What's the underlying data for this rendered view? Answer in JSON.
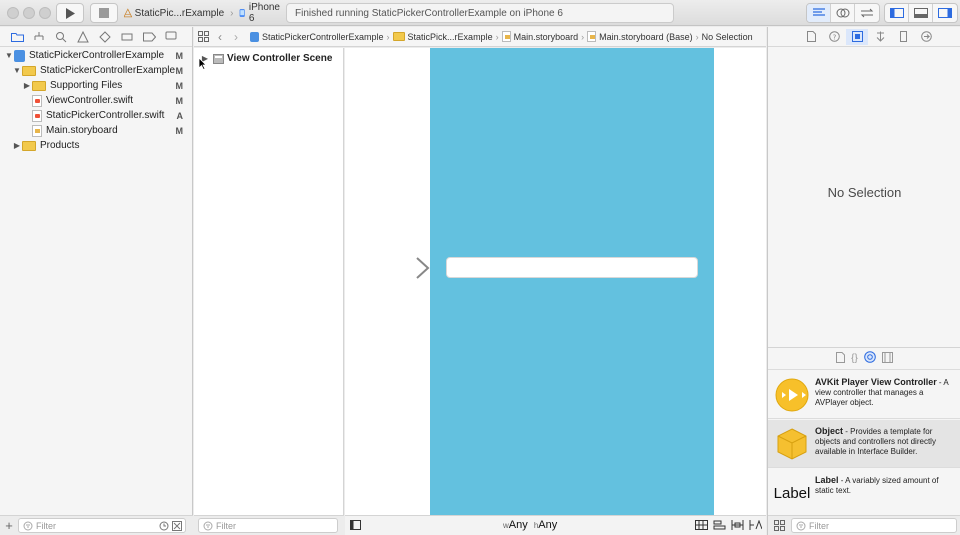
{
  "toolbar": {
    "scheme_target": "StaticPic...rExample",
    "device": "iPhone 6",
    "status": "Finished running StaticPickerControllerExample on iPhone 6"
  },
  "navigator": {
    "items": [
      {
        "label": "StaticPickerControllerExample",
        "badge": "M",
        "kind": "project",
        "level": 0,
        "expanded": true
      },
      {
        "label": "StaticPickerControllerExample",
        "badge": "M",
        "kind": "folder",
        "level": 1,
        "expanded": true
      },
      {
        "label": "Supporting Files",
        "badge": "M",
        "kind": "folder",
        "level": 2,
        "expanded": false
      },
      {
        "label": "ViewController.swift",
        "badge": "M",
        "kind": "swift",
        "level": 2
      },
      {
        "label": "StaticPickerController.swift",
        "badge": "A",
        "kind": "swift",
        "level": 2
      },
      {
        "label": "Main.storyboard",
        "badge": "M",
        "kind": "storyboard",
        "level": 2
      },
      {
        "label": "Products",
        "badge": "",
        "kind": "folder",
        "level": 1,
        "expanded": false
      }
    ],
    "filter_placeholder": "Filter"
  },
  "jumpbar": {
    "crumbs": [
      "StaticPickerControllerExample",
      "StaticPick...rExample",
      "Main.storyboard",
      "Main.storyboard (Base)",
      "No Selection"
    ]
  },
  "outline": {
    "scene": "View Controller Scene",
    "filter_placeholder": "Filter"
  },
  "canvas": {
    "size_class_w_prefix": "w",
    "size_class_w": "Any",
    "size_class_h_prefix": "h",
    "size_class_h": "Any"
  },
  "inspector": {
    "empty_text": "No Selection"
  },
  "library": {
    "items": [
      {
        "title": "AVKit Player View Controller",
        "desc": " - A view controller that manages a AVPlayer object."
      },
      {
        "title": "Object",
        "desc": " - Provides a template for objects and controllers not directly available in Interface Builder."
      },
      {
        "title": "Label",
        "desc": " - A variably sized amount of static text.",
        "icon_text": "Label"
      }
    ],
    "filter_placeholder": "Filter"
  },
  "colors": {
    "view_background": "#63c1df",
    "accent": "#3b82f6"
  }
}
